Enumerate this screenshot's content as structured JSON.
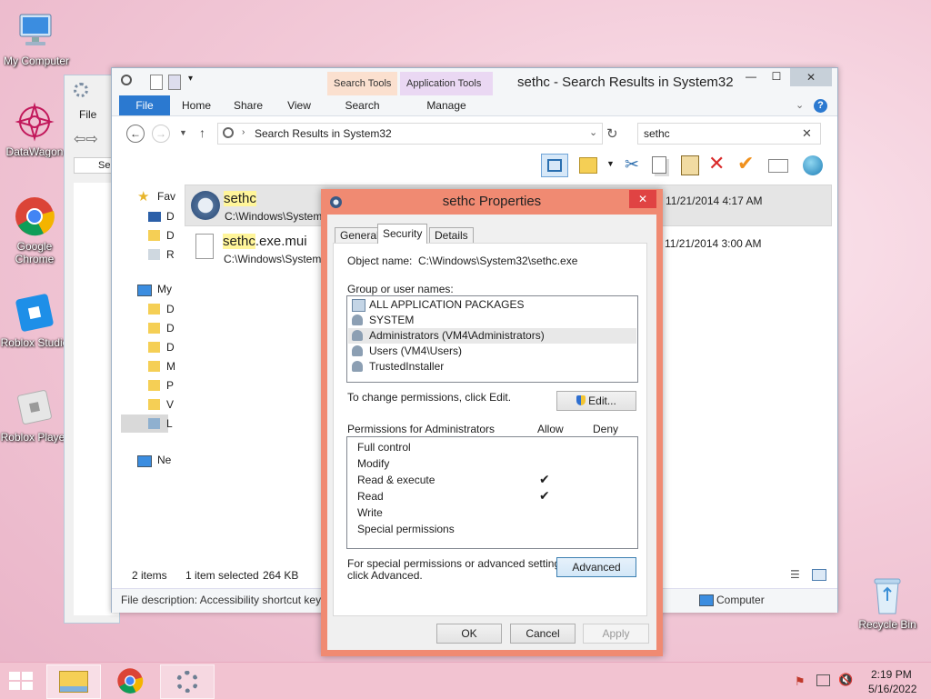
{
  "desktop": {
    "icons": [
      {
        "label": "My Computer"
      },
      {
        "label": "DataWagon"
      },
      {
        "label": "Google Chrome"
      },
      {
        "label": "Roblox Studio"
      },
      {
        "label": "Roblox Player"
      },
      {
        "label": "Recycle Bin"
      }
    ]
  },
  "bgwindow": {
    "file_tab": "File",
    "search_label": "Ser"
  },
  "explorer": {
    "title": "sethc - Search Results in System32",
    "context_tabs": {
      "search_tools": "Search Tools",
      "application_tools": "Application Tools"
    },
    "ribbon_tabs": [
      "File",
      "Home",
      "Share",
      "View",
      "Search",
      "Manage"
    ],
    "address": "Search Results in System32",
    "search_value": "sethc",
    "nav": {
      "favorites": "Fav",
      "fav_items": [
        "D",
        "D",
        "R"
      ],
      "computer": "My",
      "computer_items": [
        "D",
        "D",
        "D",
        "M",
        "P",
        "V",
        "L"
      ],
      "network": "Ne"
    },
    "results": [
      {
        "highlight": "sethc",
        "rest": "",
        "path": "C:\\Windows\\System",
        "date": "11/21/2014 4:17 AM"
      },
      {
        "highlight": "sethc",
        "rest": ".exe.mui",
        "path": "C:\\Windows\\System",
        "date": "11/21/2014 3:00 AM"
      }
    ],
    "status": {
      "count": "2 items",
      "selected": "1 item selected",
      "size": "264 KB"
    },
    "details_bar": {
      "description": "File description: Accessibility shortcut keys",
      "computer": "Computer"
    }
  },
  "dialog": {
    "title": "sethc Properties",
    "tabs": [
      "General",
      "Security",
      "Details"
    ],
    "object_label": "Object name:",
    "object_value": "C:\\Windows\\System32\\sethc.exe",
    "group_label": "Group or user names:",
    "groups": [
      "ALL APPLICATION PACKAGES",
      "SYSTEM",
      "Administrators (VM4\\Administrators)",
      "Users (VM4\\Users)",
      "TrustedInstaller"
    ],
    "change_text": "To change permissions, click Edit.",
    "edit_button": "Edit...",
    "perm_label": "Permissions for Administrators",
    "allow_label": "Allow",
    "deny_label": "Deny",
    "permissions": [
      "Full control",
      "Modify",
      "Read & execute",
      "Read",
      "Write",
      "Special permissions"
    ],
    "checkmark": "✔",
    "special_text_1": "For special permissions or advanced settings,",
    "special_text_2": "click Advanced.",
    "advanced_button": "Advanced",
    "ok_button": "OK",
    "cancel_button": "Cancel",
    "apply_button": "Apply",
    "close_glyph": "✕"
  },
  "taskbar": {
    "time": "2:19 PM",
    "date": "5/16/2022"
  },
  "colors": {
    "accent_blue": "#2b79d0",
    "dialog_frame": "#f08a72",
    "close_red": "#e04343",
    "highlight_yellow": "#fff59a"
  }
}
